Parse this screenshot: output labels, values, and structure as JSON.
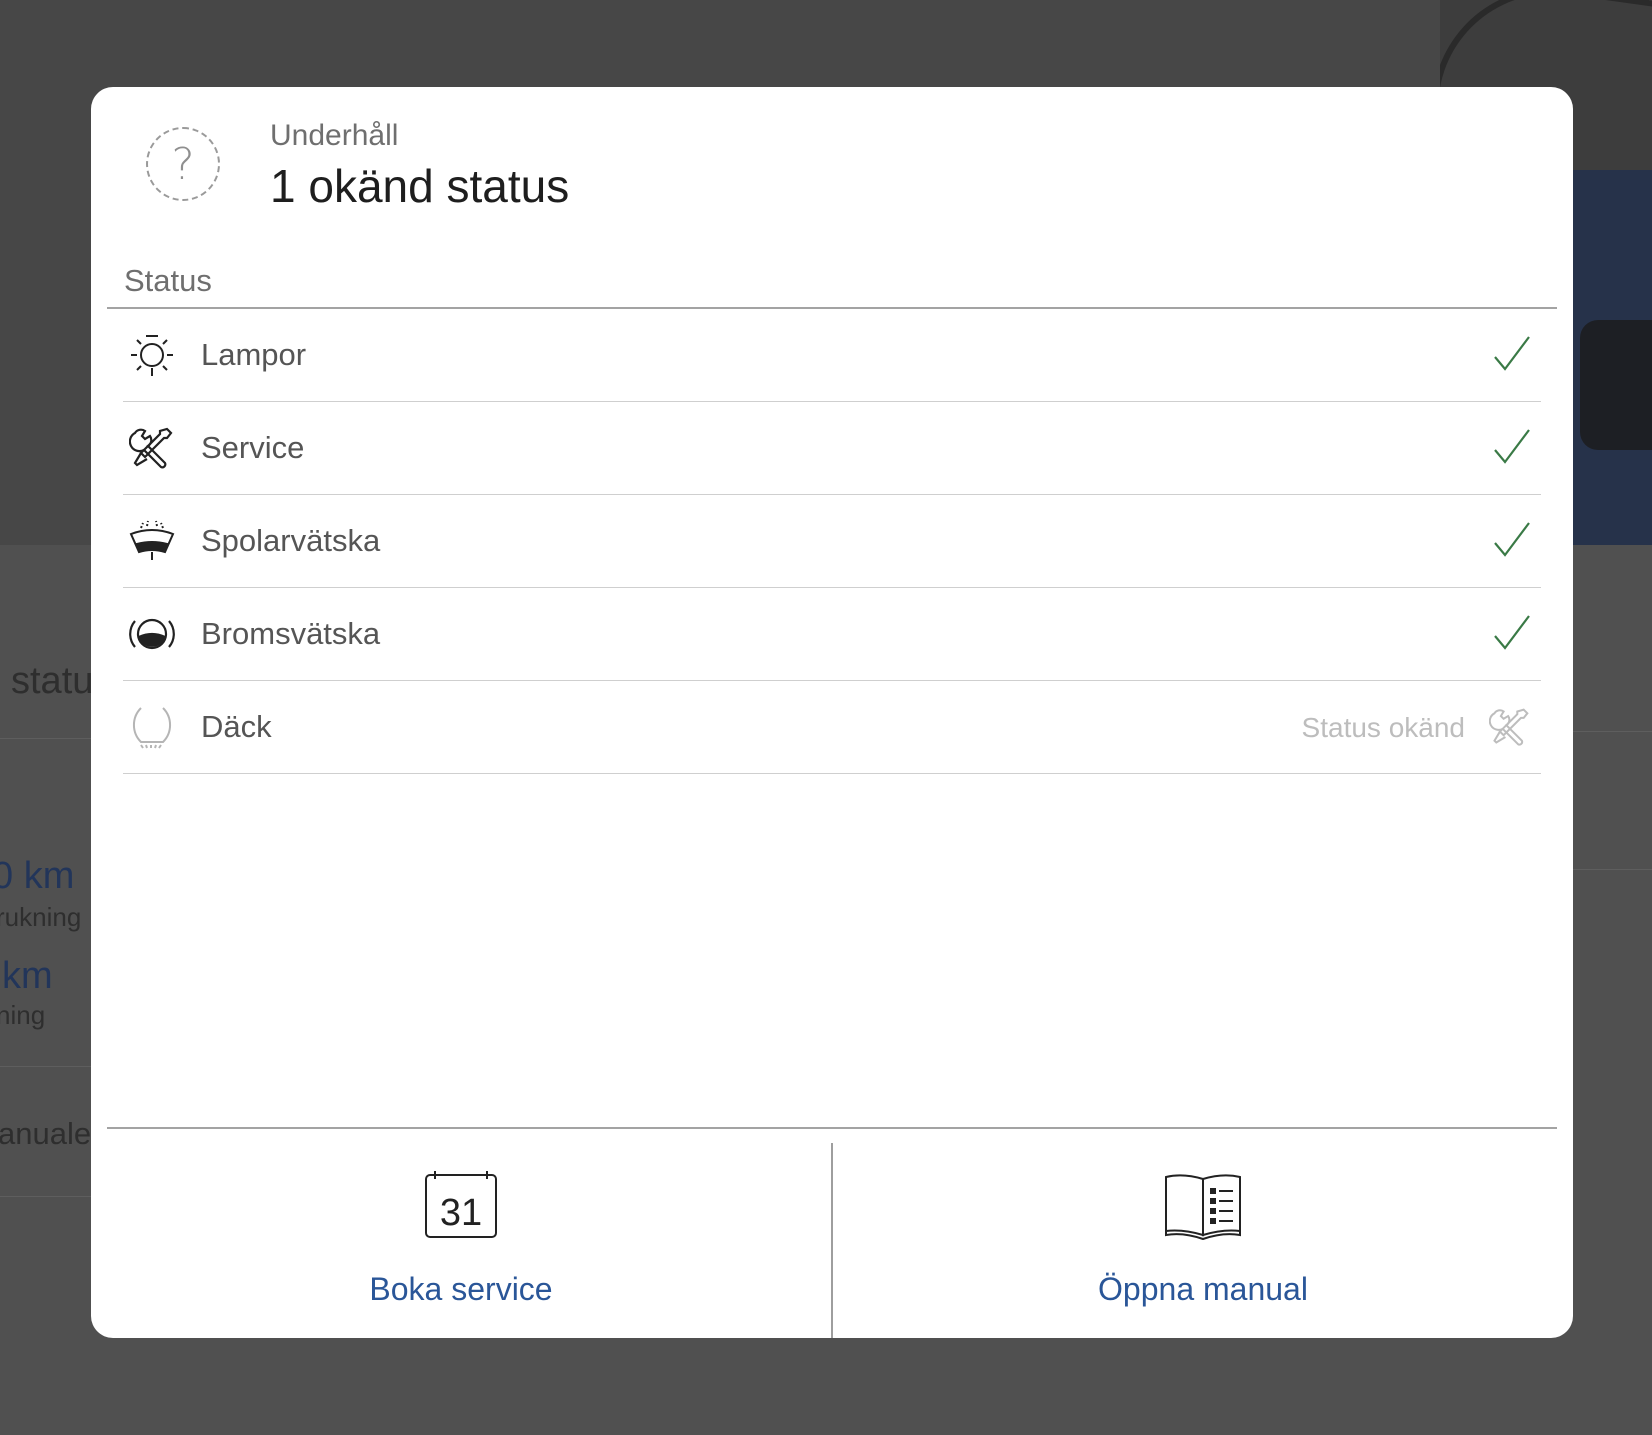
{
  "background": {
    "texts": [
      "statu",
      "0 km",
      "rukning",
      "km",
      "ning",
      "anuale"
    ]
  },
  "modal": {
    "category": "Underhåll",
    "title": "1 okänd status",
    "icon": "question-circle-icon",
    "section_label": "Status",
    "items": [
      {
        "label": "Lampor",
        "icon": "lamp-icon",
        "status": "ok"
      },
      {
        "label": "Service",
        "icon": "wrench-screwdriver-icon",
        "status": "ok"
      },
      {
        "label": "Spolarvätska",
        "icon": "washer-fluid-icon",
        "status": "ok"
      },
      {
        "label": "Bromsvätska",
        "icon": "brake-fluid-icon",
        "status": "ok"
      },
      {
        "label": "Däck",
        "icon": "tire-icon",
        "status": "unknown",
        "status_text": "Status okänd"
      }
    ],
    "actions": {
      "book_service": {
        "label": "Boka service",
        "icon": "calendar-icon",
        "icon_text": "31"
      },
      "open_manual": {
        "label": "Öppna manual",
        "icon": "manual-book-icon"
      }
    },
    "colors": {
      "ok": "#3a7a46",
      "link": "#2a5698",
      "unknown": "#bdbdbd"
    }
  }
}
